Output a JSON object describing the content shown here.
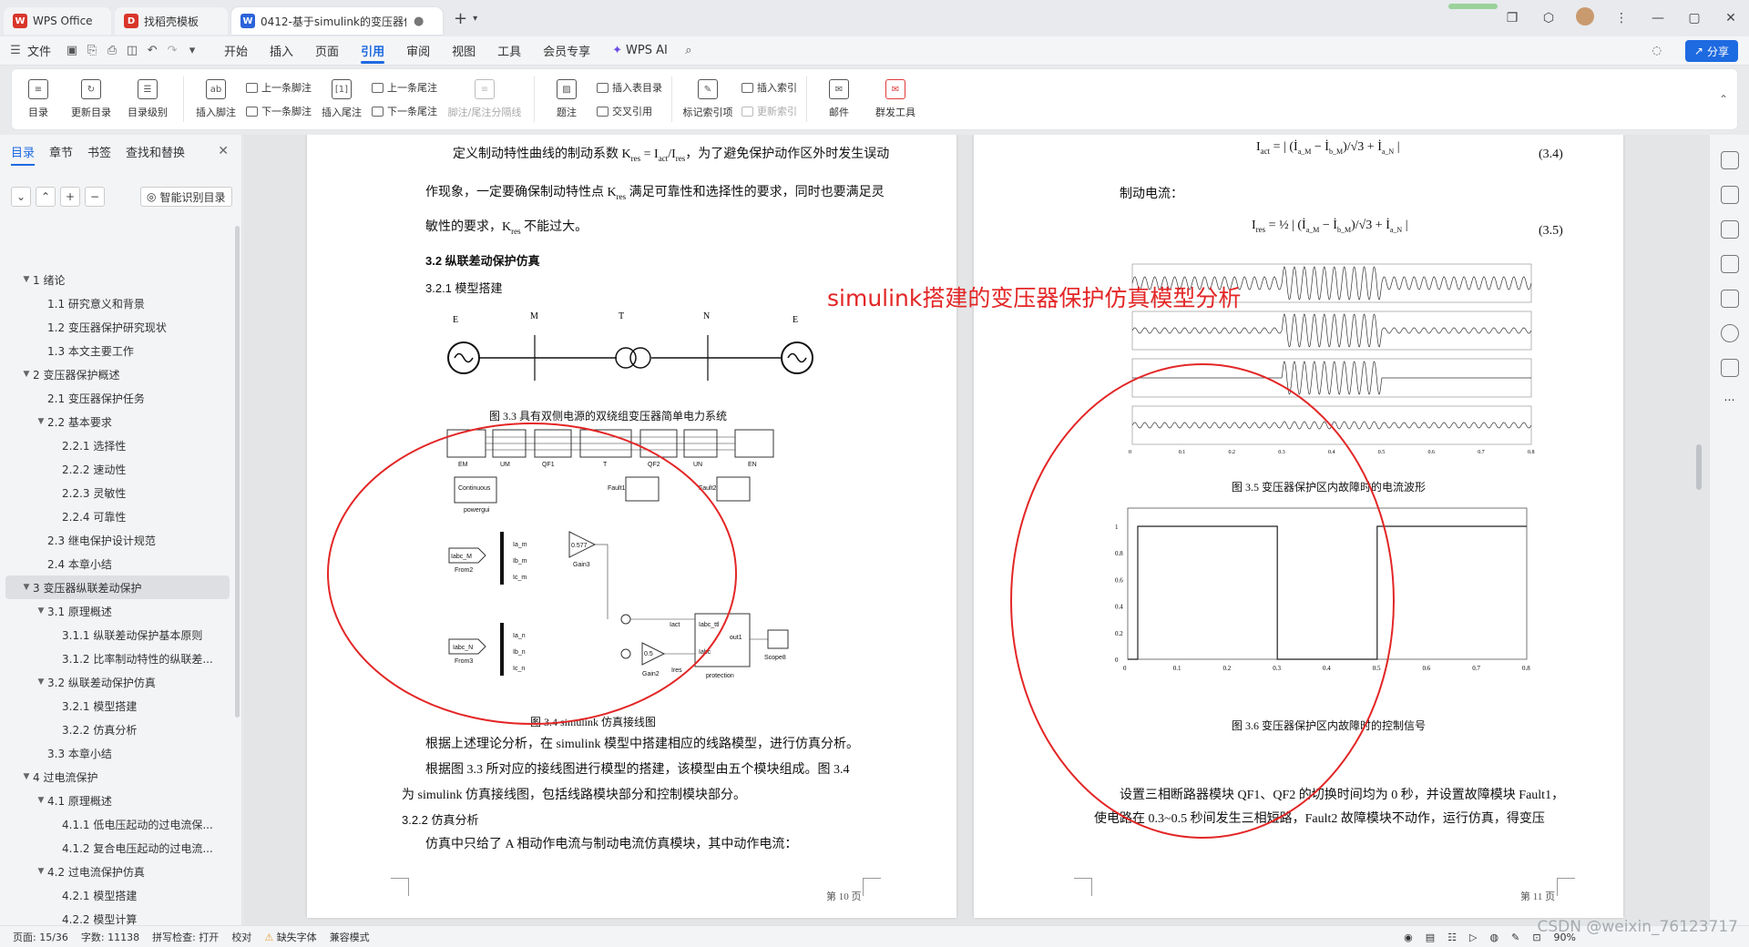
{
  "tabs": [
    {
      "label": "WPS Office",
      "icon": "W",
      "color": "#d9362b"
    },
    {
      "label": "找稻壳模板",
      "icon": "D",
      "color": "#d9362b"
    },
    {
      "label": "0412-基于simulink的变压器保...",
      "icon": "W",
      "color": "#2b63d9"
    }
  ],
  "menu": {
    "file": "文件",
    "items": [
      "开始",
      "插入",
      "页面",
      "引用",
      "审阅",
      "视图",
      "工具",
      "会员专享"
    ],
    "active": "引用",
    "wps_ai": "WPS AI",
    "share": "分享"
  },
  "ribbon": {
    "toc": "目录",
    "update_toc": "更新目录",
    "toc_level": "目录级别",
    "insert_footnote": "插入脚注",
    "prev_footnote": "上一条脚注",
    "next_footnote": "下一条脚注",
    "insert_endnote": "插入尾注",
    "prev_endnote": "上一条尾注",
    "next_endnote": "下一条尾注",
    "note_sep": "脚注/尾注分隔线",
    "caption": "题注",
    "insert_fig_toc": "插入表目录",
    "cross_ref": "交叉引用",
    "mark_index": "标记索引项",
    "insert_index": "插入索引",
    "update_index": "更新索引",
    "mail": "邮件",
    "mass_tool": "群发工具"
  },
  "sidebar": {
    "tabs": [
      "目录",
      "章节",
      "书签",
      "查找和替换"
    ],
    "smart": "智能识别目录",
    "toc": [
      {
        "level": 1,
        "arrow": "▼",
        "label": "1   绪论"
      },
      {
        "level": 2,
        "arrow": "",
        "label": "1.1   研究意义和背景"
      },
      {
        "level": 2,
        "arrow": "",
        "label": "1.2   变压器保护研究现状"
      },
      {
        "level": 2,
        "arrow": "",
        "label": "1.3   本文主要工作"
      },
      {
        "level": 1,
        "arrow": "▼",
        "label": "2   变压器保护概述"
      },
      {
        "level": 2,
        "arrow": "",
        "label": "2.1   变压器保护任务"
      },
      {
        "level": 2,
        "arrow": "▼",
        "label": "2.2 基本要求"
      },
      {
        "level": 3,
        "arrow": "",
        "label": "2.2.1   选择性"
      },
      {
        "level": 3,
        "arrow": "",
        "label": "2.2.2   速动性"
      },
      {
        "level": 3,
        "arrow": "",
        "label": "2.2.3   灵敏性"
      },
      {
        "level": 3,
        "arrow": "",
        "label": "2.2.4   可靠性"
      },
      {
        "level": 2,
        "arrow": "",
        "label": "2.3  继电保护设计规范"
      },
      {
        "level": 2,
        "arrow": "",
        "label": "2.4   本章小结"
      },
      {
        "level": 1,
        "arrow": "▼",
        "label": "3   变压器纵联差动保护",
        "selected": true
      },
      {
        "level": 2,
        "arrow": "▼",
        "label": "3.1   原理概述"
      },
      {
        "level": 3,
        "arrow": "",
        "label": "3.1.1   纵联差动保护基本原则"
      },
      {
        "level": 3,
        "arrow": "",
        "label": "3.1.2   比率制动特性的纵联差..."
      },
      {
        "level": 2,
        "arrow": "▼",
        "label": "3.2   纵联差动保护仿真"
      },
      {
        "level": 3,
        "arrow": "",
        "label": "3.2.1   模型搭建"
      },
      {
        "level": 3,
        "arrow": "",
        "label": "3.2.2   仿真分析"
      },
      {
        "level": 2,
        "arrow": "",
        "label": "3.3   本章小结"
      },
      {
        "level": 1,
        "arrow": "▼",
        "label": "4  过电流保护"
      },
      {
        "level": 2,
        "arrow": "▼",
        "label": "4.1   原理概述"
      },
      {
        "level": 3,
        "arrow": "",
        "label": "4.1.1   低电压起动的过电流保..."
      },
      {
        "level": 3,
        "arrow": "",
        "label": "4.1.2   复合电压起动的过电流..."
      },
      {
        "level": 2,
        "arrow": "▼",
        "label": "4.2   过电流保护仿真"
      },
      {
        "level": 3,
        "arrow": "",
        "label": "4.2.1   模型搭建"
      },
      {
        "level": 3,
        "arrow": "",
        "label": "4.2.2   模型计算"
      }
    ]
  },
  "page1": {
    "line1": "定义制动特性曲线的制动系数 K",
    "line1b": "，为了避免保护动作区外时发生误动",
    "line2": "作现象，一定要确保制动特性点 K",
    "line2b": " 满足可靠性和选择性的要求，同时也要满足灵",
    "line3": "敏性的要求，K",
    "line3b": " 不能过大。",
    "h32": "3.2    纵联差动保护仿真",
    "h321": "3.2.1    模型搭建",
    "fig33": "图 3.3  具有双侧电源的双绕组变压器简单电力系统",
    "fig34": "图 3.4 simulink 仿真接线图",
    "p_a": "根据上述理论分析，在 simulink 模型中搭建相应的线路模型，进行仿真分析。",
    "p_b": "根据图 3.3 所对应的接线图进行模型的搭建，该模型由五个模块组成。图 3.4",
    "p_c": "为 simulink 仿真接线图，包括线路模块部分和控制模块部分。",
    "h322": "3.2.2    仿真分析",
    "p_d": "仿真中只给了 A 相动作电流与制动电流仿真模块，其中动作电流：",
    "pagenum": "第 10 页",
    "labels": {
      "em": "EM",
      "um": "UM",
      "qf1": "QF1",
      "t": "T",
      "qf2": "QF2",
      "un": "UN",
      "en": "EN",
      "powergui": "powergui",
      "continuous": "Continuous",
      "fault1": "Fault1",
      "fault2": "Fault2",
      "from2": "From2",
      "from3": "From3",
      "iabc_m": "Iabc_M",
      "iabc_n": "Iabc_N",
      "gain3": "Gain3",
      "gain2": "Gain2",
      "g3": "0.577",
      "g2": "0.5",
      "iact": "Iact",
      "ires": "Ires",
      "protection": "protection",
      "scope": "Scope8",
      "iabc_ttl": "Iabc_ttl",
      "iabc": "Iabc",
      "out1": "out1",
      "ia_m": "Ia_m",
      "ib_m": "Ib_m",
      "ic_m": "Ic_m",
      "ia_n": "Ia_n",
      "ib_n": "Ib_n",
      "ic_n": "Ic_n",
      "em_top": "E",
      "m_top": "M",
      "t_top": "T",
      "n_top": "N",
      "en_top": "E"
    }
  },
  "page2": {
    "eq1": "(3.4)",
    "eq2": "(3.5)",
    "zhidong": "制动电流：",
    "fig35": "图 3.5  变压器保护区内故障时的电流波形",
    "fig36": "图 3.6  变压器保护区内故障时的控制信号",
    "p_a": "设置三相断路器模块 QF1、QF2 的切换时间均为 0 秒，并设置故障模块 Fault1，",
    "p_b": "使电路在 0.3~0.5 秒间发生三相短路，Fault2 故障模块不动作，运行仿真，得变压",
    "pagenum": "第 11 页",
    "yticks": [
      "1",
      "0.8",
      "0.6",
      "0.4",
      "0.2",
      "0"
    ],
    "xticks": [
      "0",
      "0.1",
      "0.2",
      "0.3",
      "0.4",
      "0.5",
      "0.6",
      "0.7",
      "0.8"
    ]
  },
  "annotation": "simulink搭建的变压器保护仿真模型分析",
  "status": {
    "page": "页面: 15/36",
    "words": "字数: 11138",
    "spell": "拼写检查: 打开",
    "proof": "校对",
    "missing_font": "缺失字体",
    "compat": "兼容模式",
    "zoom": "90%"
  },
  "watermark": "CSDN @weixin_76123717",
  "chart_data": [
    {
      "type": "line",
      "title": "图 3.5  变压器保护区内故障时的电流波形",
      "xlim": [
        0,
        0.8
      ],
      "x_ticks": [
        0,
        0.1,
        0.2,
        0.3,
        0.4,
        0.5,
        0.6,
        0.7,
        0.8
      ],
      "fault_interval": [
        0.3,
        0.5
      ],
      "panels": 4
    },
    {
      "type": "line",
      "title": "图 3.6  变压器保护区内故障时的控制信号",
      "xlim": [
        0,
        0.8
      ],
      "ylim": [
        0,
        1
      ],
      "x": [
        0,
        0.02,
        0.02,
        0.3,
        0.3,
        0.5,
        0.5,
        0.8
      ],
      "values": [
        0,
        0,
        1,
        1,
        0,
        0,
        1,
        1
      ]
    }
  ]
}
